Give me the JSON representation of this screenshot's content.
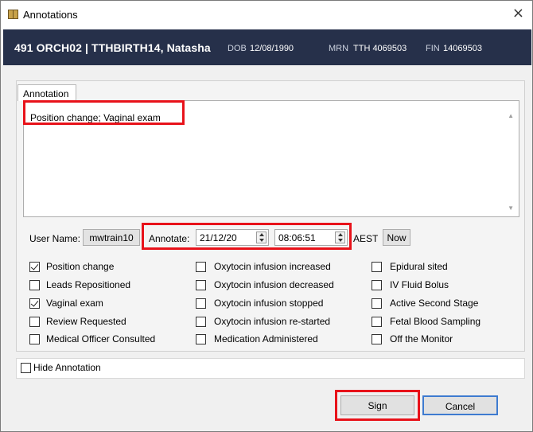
{
  "window": {
    "title": "Annotations",
    "close_glyph": "×"
  },
  "banner": {
    "patient": "491 ORCH02 | TTHBIRTH14, Natasha",
    "dob_label": "DOB",
    "dob": "12/08/1990",
    "mrn_label": "MRN",
    "mrn": "TTH 4069503",
    "fin_label": "FIN",
    "fin": "14069503"
  },
  "tab": {
    "label": "Annotation"
  },
  "annotation": {
    "text": "Position change; Vaginal exam"
  },
  "meta_row": {
    "user_label": "User Name:",
    "user": "mwtrain10",
    "annotate_label": "Annotate:",
    "date": "21/12/20",
    "time": "08:06:51",
    "tz": "AEST",
    "now_label": "Now"
  },
  "checkboxes": {
    "col1": [
      {
        "label": "Position change",
        "checked": true
      },
      {
        "label": "Leads Repositioned",
        "checked": false
      },
      {
        "label": "Vaginal exam",
        "checked": true
      },
      {
        "label": "Review Requested",
        "checked": false
      },
      {
        "label": "Medical Officer Consulted",
        "checked": false
      }
    ],
    "col2": [
      {
        "label": "Oxytocin infusion increased",
        "checked": false
      },
      {
        "label": "Oxytocin infusion decreased",
        "checked": false
      },
      {
        "label": "Oxytocin infusion stopped",
        "checked": false
      },
      {
        "label": "Oxytocin infusion re-started",
        "checked": false
      },
      {
        "label": "Medication Administered",
        "checked": false
      }
    ],
    "col3": [
      {
        "label": "Epidural sited",
        "checked": false
      },
      {
        "label": "IV Fluid Bolus",
        "checked": false
      },
      {
        "label": "Active Second Stage",
        "checked": false
      },
      {
        "label": "Fetal Blood Sampling",
        "checked": false
      },
      {
        "label": "Off the Monitor",
        "checked": false
      }
    ]
  },
  "hide_annotation": {
    "label": "Hide Annotation",
    "checked": false
  },
  "buttons": {
    "sign": "Sign",
    "cancel": "Cancel"
  },
  "colors": {
    "banner": "#26304a",
    "highlight": "#e8121a",
    "focus": "#3e7bd0"
  },
  "icons": {
    "window_icon": "book-icon",
    "close": "close-icon",
    "scroll_up": "scroll-up-icon",
    "scroll_down": "scroll-down-icon",
    "spin": "spin-icon"
  }
}
